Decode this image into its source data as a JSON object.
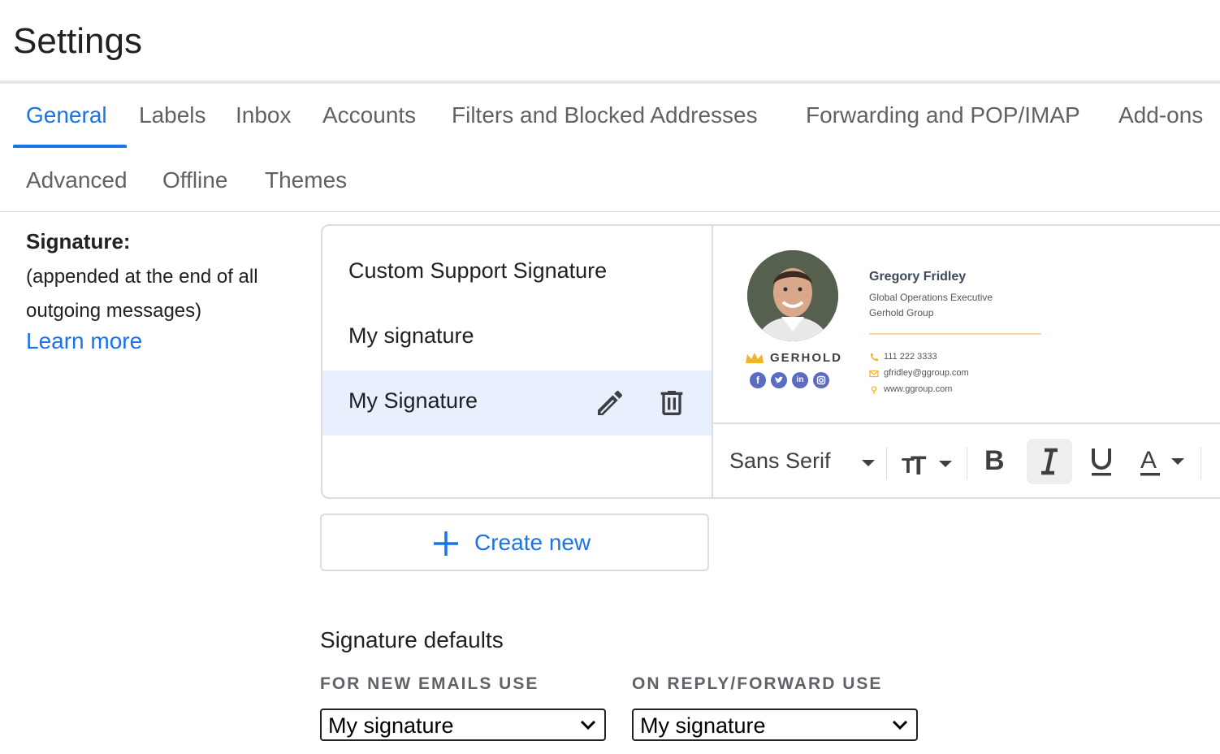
{
  "header": {
    "title": "Settings"
  },
  "tabs": {
    "row1": [
      {
        "label": "General",
        "active": true
      },
      {
        "label": "Labels"
      },
      {
        "label": "Inbox"
      },
      {
        "label": "Accounts"
      },
      {
        "label": "Filters and Blocked Addresses"
      },
      {
        "label": "Forwarding and POP/IMAP"
      },
      {
        "label": "Add-ons"
      }
    ],
    "row2": [
      {
        "label": "Advanced"
      },
      {
        "label": "Offline"
      },
      {
        "label": "Themes"
      }
    ]
  },
  "signature_section": {
    "label": "Signature:",
    "description": "(appended at the end of all outgoing messages)",
    "learn_more": "Learn more"
  },
  "signatures": {
    "items": [
      {
        "label": "Custom Support Signature"
      },
      {
        "label": "My signature"
      },
      {
        "label": "My Signature",
        "selected": true
      }
    ]
  },
  "signature_preview": {
    "name": "Gregory Fridley",
    "job_title": "Global Operations Executive",
    "company": "Gerhold Group",
    "brand": "GERHOLD",
    "phone": "111 222 3333",
    "email": "gfridley@ggroup.com",
    "website": "www.ggroup.com",
    "social_icons": [
      "facebook-icon",
      "twitter-icon",
      "linkedin-icon",
      "instagram-icon"
    ]
  },
  "toolbar": {
    "font": "Sans Serif",
    "buttons": [
      "text-size-icon",
      "bold-icon",
      "italic-icon",
      "underline-icon",
      "text-color-icon"
    ],
    "italic_active": true
  },
  "create_new": {
    "label": "Create new"
  },
  "defaults": {
    "title": "Signature defaults",
    "new_emails_label": "FOR NEW EMAILS USE",
    "new_emails_value": "My signature",
    "reply_label": "ON REPLY/FORWARD USE",
    "reply_value": "My signature"
  },
  "colors": {
    "accent": "#1a73e8",
    "selected_bg": "#e8f0fe",
    "social_icon": "#5b6bc0",
    "signature_accent": "#f0b429"
  }
}
